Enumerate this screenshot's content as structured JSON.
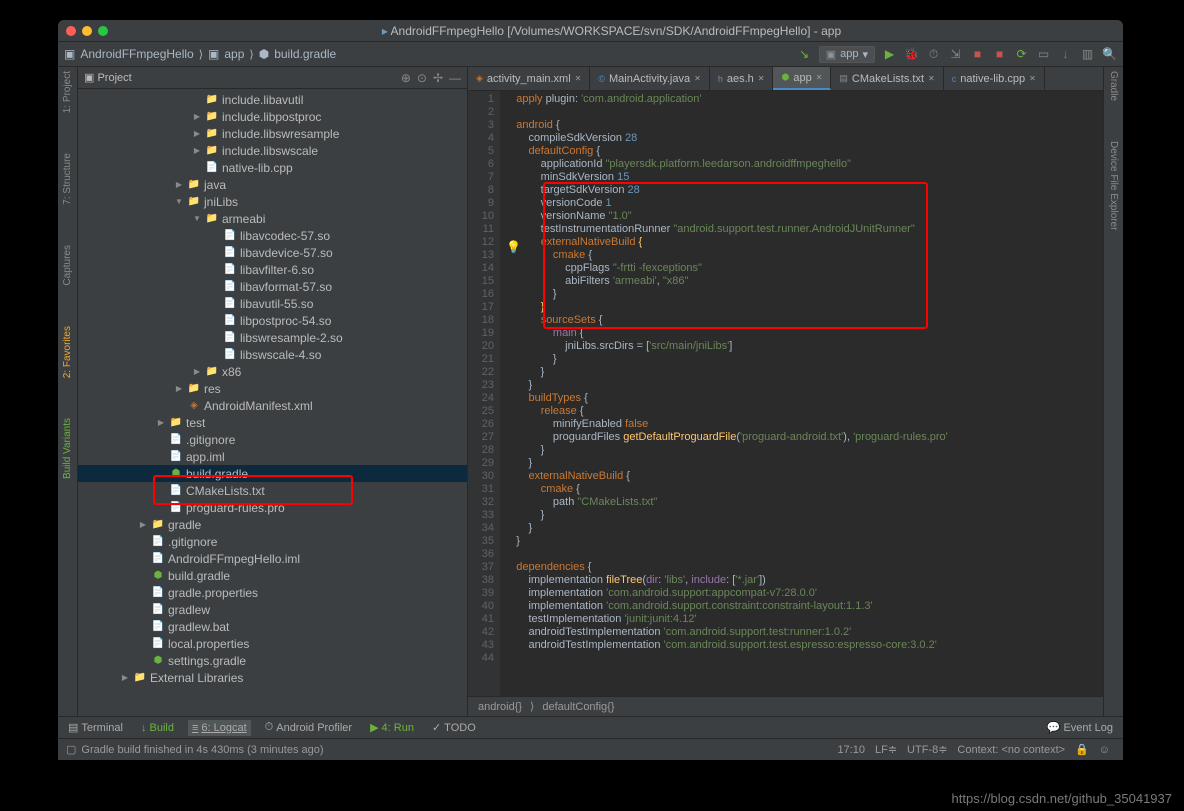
{
  "window_title": "AndroidFFmpegHello [/Volumes/WORKSPACE/svn/SDK/AndroidFFmpegHello] - app",
  "breadcrumb": {
    "project": "AndroidFFmpegHello",
    "module": "app",
    "file": "build.gradle"
  },
  "run_config": "app",
  "sidetabs_left": [
    "1: Project",
    "7: Structure",
    "Captures",
    "2: Favorites",
    "Build Variants"
  ],
  "sidetabs_right": [
    "Gradle",
    "Device File Explorer"
  ],
  "project": {
    "title": "Project",
    "tree": [
      {
        "d": 3,
        "a": "",
        "i": "fold",
        "t": "include.libavutil"
      },
      {
        "d": 3,
        "a": "▶",
        "i": "fold",
        "t": "include.libpostproc"
      },
      {
        "d": 3,
        "a": "▶",
        "i": "fold",
        "t": "include.libswresample"
      },
      {
        "d": 3,
        "a": "▶",
        "i": "fold",
        "t": "include.libswscale"
      },
      {
        "d": 3,
        "a": "",
        "i": "file",
        "t": "native-lib.cpp"
      },
      {
        "d": 2,
        "a": "▶",
        "i": "fold",
        "t": "java"
      },
      {
        "d": 2,
        "a": "▼",
        "i": "fold",
        "t": "jniLibs"
      },
      {
        "d": 3,
        "a": "▼",
        "i": "fold",
        "t": "armeabi"
      },
      {
        "d": 4,
        "a": "",
        "i": "file",
        "t": "libavcodec-57.so"
      },
      {
        "d": 4,
        "a": "",
        "i": "file",
        "t": "libavdevice-57.so"
      },
      {
        "d": 4,
        "a": "",
        "i": "file",
        "t": "libavfilter-6.so"
      },
      {
        "d": 4,
        "a": "",
        "i": "file",
        "t": "libavformat-57.so"
      },
      {
        "d": 4,
        "a": "",
        "i": "file",
        "t": "libavutil-55.so"
      },
      {
        "d": 4,
        "a": "",
        "i": "file",
        "t": "libpostproc-54.so"
      },
      {
        "d": 4,
        "a": "",
        "i": "file",
        "t": "libswresample-2.so"
      },
      {
        "d": 4,
        "a": "",
        "i": "file",
        "t": "libswscale-4.so"
      },
      {
        "d": 3,
        "a": "▶",
        "i": "fold",
        "t": "x86"
      },
      {
        "d": 2,
        "a": "▶",
        "i": "fold",
        "t": "res"
      },
      {
        "d": 2,
        "a": "",
        "i": "xml",
        "t": "AndroidManifest.xml"
      },
      {
        "d": 1,
        "a": "▶",
        "i": "fold",
        "t": "test"
      },
      {
        "d": 1,
        "a": "",
        "i": "file",
        "t": ".gitignore"
      },
      {
        "d": 1,
        "a": "",
        "i": "file",
        "t": "app.iml"
      },
      {
        "d": 1,
        "a": "",
        "i": "grd",
        "t": "build.gradle",
        "sel": true
      },
      {
        "d": 1,
        "a": "",
        "i": "file",
        "t": "CMakeLists.txt"
      },
      {
        "d": 1,
        "a": "",
        "i": "file",
        "t": "proguard-rules.pro"
      },
      {
        "d": 0,
        "a": "▶",
        "i": "fold",
        "t": "gradle"
      },
      {
        "d": 0,
        "a": "",
        "i": "file",
        "t": ".gitignore"
      },
      {
        "d": 0,
        "a": "",
        "i": "file",
        "t": "AndroidFFmpegHello.iml"
      },
      {
        "d": 0,
        "a": "",
        "i": "grd",
        "t": "build.gradle"
      },
      {
        "d": 0,
        "a": "",
        "i": "file",
        "t": "gradle.properties"
      },
      {
        "d": 0,
        "a": "",
        "i": "file",
        "t": "gradlew"
      },
      {
        "d": 0,
        "a": "",
        "i": "file",
        "t": "gradlew.bat"
      },
      {
        "d": 0,
        "a": "",
        "i": "file",
        "t": "local.properties"
      },
      {
        "d": 0,
        "a": "",
        "i": "grd",
        "t": "settings.gradle"
      },
      {
        "d": -1,
        "a": "▶",
        "i": "fold",
        "t": "External Libraries"
      }
    ]
  },
  "tabs": [
    "activity_main.xml",
    "MainActivity.java",
    "aes.h",
    "app",
    "CMakeLists.txt",
    "native-lib.cpp"
  ],
  "active_tab": 3,
  "code_lines": [
    "<span class='k'>apply</span> plugin: <span class='s'>'com.android.application'</span>",
    "",
    "<span class='k'>android</span> {",
    "    compileSdkVersion <span class='n'>28</span>",
    "    <span class='k'>defaultConfig</span> {",
    "        applicationId <span class='s'>\"playersdk.platform.leedarson.androidffmpeghello\"</span>",
    "        minSdkVersion <span class='n'>15</span>",
    "        targetSdkVersion <span class='n'>28</span>",
    "        versionCode <span class='n'>1</span>",
    "        versionName <span class='s'>\"1.0\"</span>",
    "        testInstrumentationRunner <span class='s'>\"android.support.test.runner.AndroidJUnitRunner\"</span>",
    "        <span class='k'>externalNativeBuild</span> <span class='m'>{</span>",
    "            <span class='k'>cmake</span> {",
    "                cppFlags <span class='s'>\"-frtti -fexceptions\"</span>",
    "                abiFilters <span class='s'>'armeabi'</span>, <span class='s'>\"x86\"</span>",
    "            }",
    "        <span class='m'>}</span>",
    "        <span class='k'>sourceSets</span> {",
    "            <span class='i'>main</span> {",
    "                jniLibs.srcDirs = [<span class='s'>'src/main/jniLibs'</span>]",
    "            }",
    "        }",
    "    }",
    "    <span class='k'>buildTypes</span> {",
    "        <span class='k'>release</span> {",
    "            minifyEnabled <span class='k'>false</span>",
    "            proguardFiles <span class='m'>getDefaultProguardFile</span>(<span class='s'>'proguard-android.txt'</span>), <span class='s'>'proguard-rules.pro'</span>",
    "        }",
    "    }",
    "    <span class='k'>externalNativeBuild</span> {",
    "        <span class='k'>cmake</span> {",
    "            path <span class='s'>\"CMakeLists.txt\"</span>",
    "        }",
    "    }",
    "}",
    "",
    "<span class='k'>dependencies</span> {",
    "    implementation <span class='m'>fileTree</span>(<span class='i'>dir</span>: <span class='s'>'libs'</span>, <span class='i'>include</span>: [<span class='s'>'*.jar'</span>])",
    "    implementation <span class='s'>'com.android.support:appcompat-v7:28.0.0'</span>",
    "    implementation <span class='s'>'com.android.support.constraint:constraint-layout:1.1.3'</span>",
    "    testImplementation <span class='s'>'junit:junit:4.12'</span>",
    "    androidTestImplementation <span class='s'>'com.android.support.test:runner:1.0.2'</span>",
    "    androidTestImplementation <span class='s'>'com.android.support.test.espresso:espresso-core:3.0.2'</span>",
    ""
  ],
  "crumb": [
    "android{}",
    "defaultConfig{}"
  ],
  "bottom": [
    "Terminal",
    "Build",
    "6: Logcat",
    "Android Profiler",
    "4: Run",
    "TODO"
  ],
  "bottom_active": 2,
  "bottom_right": "Event Log",
  "status_msg": "Gradle build finished in 4s 430ms (3 minutes ago)",
  "status_right": {
    "pos": "17:10",
    "sep": "LF",
    "enc": "UTF-8",
    "ctx": "Context: <no context>"
  },
  "watermark": "https://blog.csdn.net/github_35041937"
}
